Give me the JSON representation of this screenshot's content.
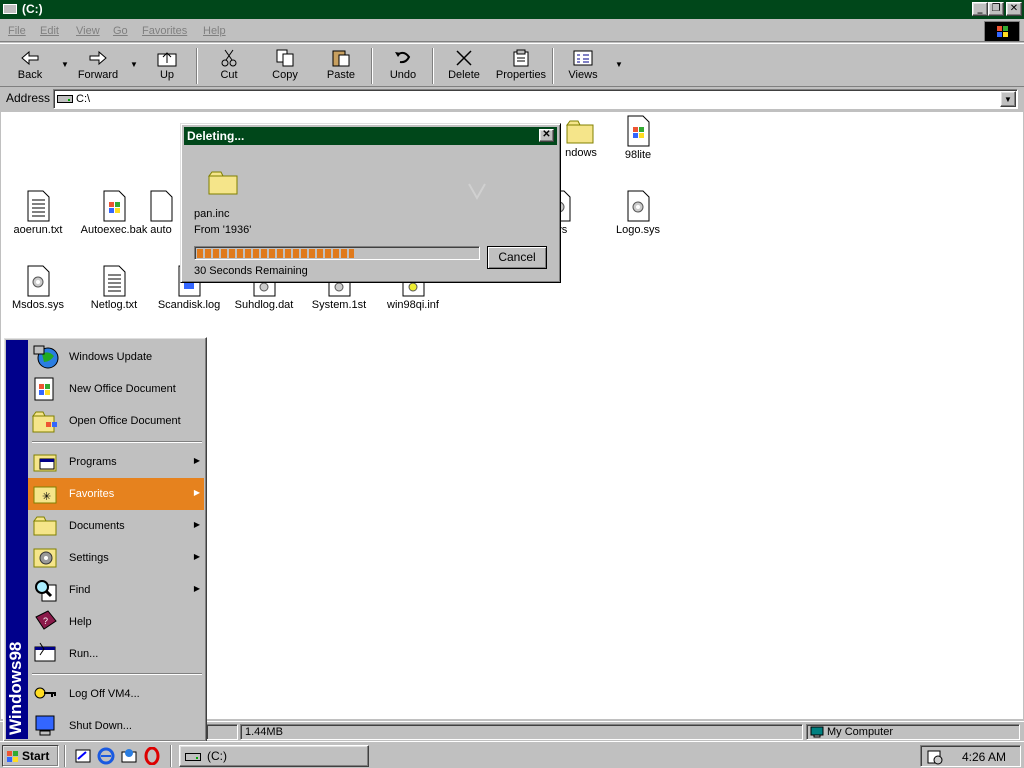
{
  "window": {
    "title": "(C:)",
    "buttons": {
      "minimize": "_",
      "restore": "❐",
      "close": "✕"
    }
  },
  "menubar": [
    "File",
    "Edit",
    "View",
    "Go",
    "Favorites",
    "Help"
  ],
  "toolbar": {
    "back": "Back",
    "forward": "Forward",
    "up": "Up",
    "cut": "Cut",
    "copy": "Copy",
    "paste": "Paste",
    "undo": "Undo",
    "delete": "Delete",
    "properties": "Properties",
    "views": "Views"
  },
  "address": {
    "label": "Address",
    "value": "C:\\"
  },
  "files": [
    {
      "name": "98lite",
      "icon": "system-file-icon"
    },
    {
      "name": "aoerun.txt",
      "icon": "text-file-icon"
    },
    {
      "name": "Autoexec.bak",
      "icon": "system-file-icon"
    },
    {
      "name": "auto",
      "icon": "system-file-icon"
    },
    {
      "name": "Logo.sys",
      "icon": "gear-file-icon"
    },
    {
      "name": "Msdos.sys",
      "icon": "gear-file-icon"
    },
    {
      "name": "Netlog.txt",
      "icon": "text-file-icon"
    },
    {
      "name": "Scandisk.log",
      "icon": "text-file-icon"
    },
    {
      "name": "Suhdlog.dat",
      "icon": "gear-file-icon"
    },
    {
      "name": "System.1st",
      "icon": "gear-file-icon"
    },
    {
      "name": "win98qi.inf",
      "icon": "gear-file-icon"
    },
    {
      "name": "ndows",
      "icon": "folder-icon"
    },
    {
      "name": "sys",
      "icon": "gear-file-icon"
    }
  ],
  "dialog": {
    "title": "Deleting...",
    "close": "✕",
    "filename": "pan.inc",
    "from": "From '1936'",
    "remaining": "30 Seconds Remaining",
    "cancel": "Cancel",
    "progress": 0.56
  },
  "startmenu": {
    "brand": "Windows98",
    "items": [
      {
        "label": "Windows Update",
        "submenu": false
      },
      {
        "label": "New Office Document",
        "submenu": false
      },
      {
        "label": "Open Office Document",
        "submenu": false
      },
      {
        "label": "Programs",
        "submenu": true
      },
      {
        "label": "Favorites",
        "submenu": true,
        "highlighted": true
      },
      {
        "label": "Documents",
        "submenu": true
      },
      {
        "label": "Settings",
        "submenu": true
      },
      {
        "label": "Find",
        "submenu": true
      },
      {
        "label": "Help",
        "submenu": false
      },
      {
        "label": "Run...",
        "submenu": false
      },
      {
        "label": "Log Off VM4...",
        "submenu": false
      },
      {
        "label": "Shut Down...",
        "submenu": false
      }
    ]
  },
  "statusbar": {
    "size": "1.44MB",
    "location": "My Computer"
  },
  "taskbar": {
    "start": "Start",
    "task": "(C:)",
    "clock": "4:26 AM"
  },
  "colors": {
    "titlebar": "#00471a",
    "highlight": "#e6821e",
    "progress": "#e07a1c"
  }
}
